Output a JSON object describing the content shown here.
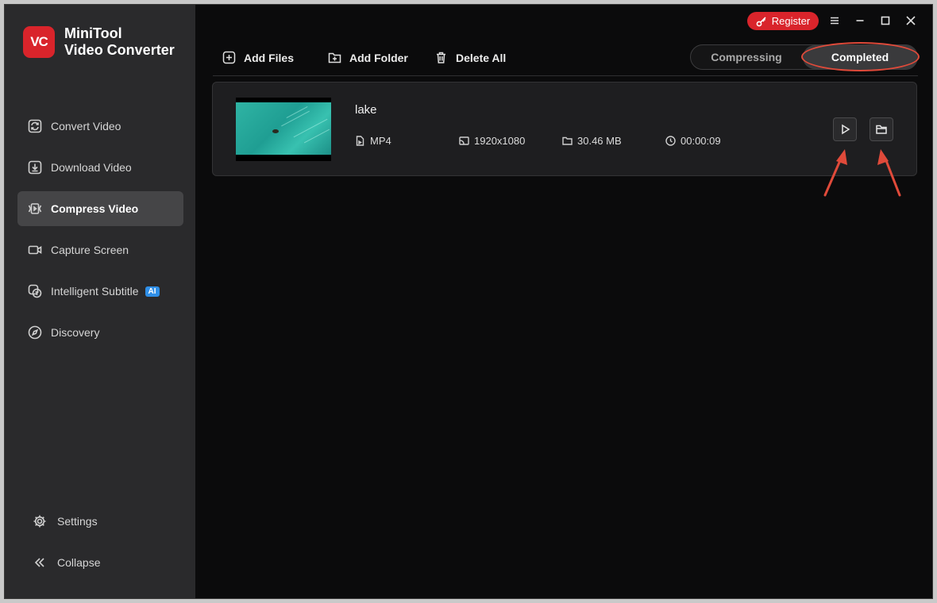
{
  "app": {
    "name_line1": "MiniTool",
    "name_line2": "Video Converter",
    "logo_text": "VC"
  },
  "topbar": {
    "register_label": "Register"
  },
  "sidebar": {
    "items": [
      {
        "label": "Convert Video",
        "icon": "refresh-icon"
      },
      {
        "label": "Download Video",
        "icon": "download-icon"
      },
      {
        "label": "Compress Video",
        "icon": "compress-icon",
        "active": true
      },
      {
        "label": "Capture Screen",
        "icon": "camera-icon"
      },
      {
        "label": "Intelligent Subtitle",
        "icon": "subtitle-icon",
        "badge": "AI"
      },
      {
        "label": "Discovery",
        "icon": "compass-icon"
      }
    ],
    "settings_label": "Settings",
    "collapse_label": "Collapse"
  },
  "toolbar": {
    "add_files": "Add Files",
    "add_folder": "Add Folder",
    "delete_all": "Delete All"
  },
  "tabs": {
    "compressing": "Compressing",
    "completed": "Completed",
    "selected": "Completed"
  },
  "file": {
    "name": "lake",
    "format": "MP4",
    "resolution": "1920x1080",
    "size": "30.46 MB",
    "duration": "00:00:09"
  },
  "colors": {
    "accent": "#d9242b",
    "annotation": "#e04a3a",
    "ai_badge": "#2f8fe8"
  }
}
